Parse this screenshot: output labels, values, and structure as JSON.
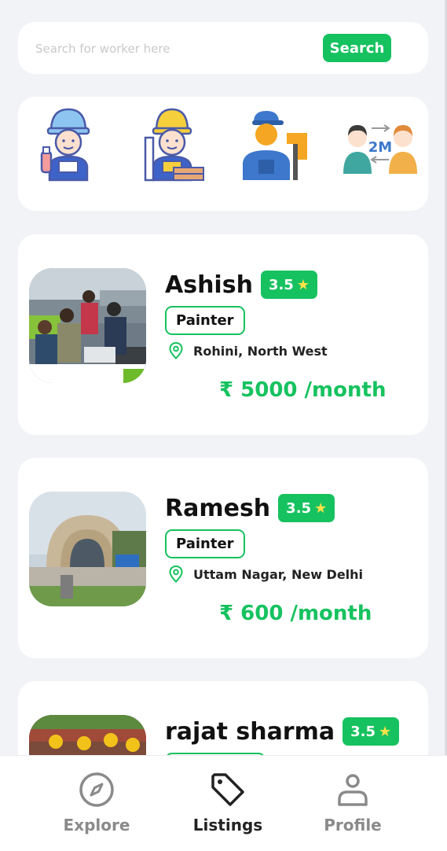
{
  "search": {
    "placeholder": "Search for worker here",
    "button_label": "Search"
  },
  "categories": [
    {
      "icon": "plumber-worker-icon"
    },
    {
      "icon": "carpenter-worker-icon"
    },
    {
      "icon": "painter-worker-icon"
    },
    {
      "icon": "hire-exchange-icon"
    }
  ],
  "workers": [
    {
      "name": "Ashish",
      "rating": "3.5",
      "role": "Painter",
      "location": "Rohini, North West",
      "price": "₹ 5000 /month"
    },
    {
      "name": "Ramesh",
      "rating": "3.5",
      "role": "Painter",
      "location": "Uttam Nagar, New Delhi",
      "price": "₹ 600 /month"
    },
    {
      "name": "rajat sharma",
      "rating": "3.5",
      "role": "",
      "location": "",
      "price": ""
    }
  ],
  "nav": {
    "items": [
      {
        "label": "Explore",
        "icon": "compass-icon"
      },
      {
        "label": "Listings",
        "icon": "tag-icon"
      },
      {
        "label": "Profile",
        "icon": "user-icon"
      }
    ],
    "active": "Listings"
  },
  "colors": {
    "accent": "#16c25f",
    "background": "#f2f3f7",
    "card": "#ffffff"
  }
}
